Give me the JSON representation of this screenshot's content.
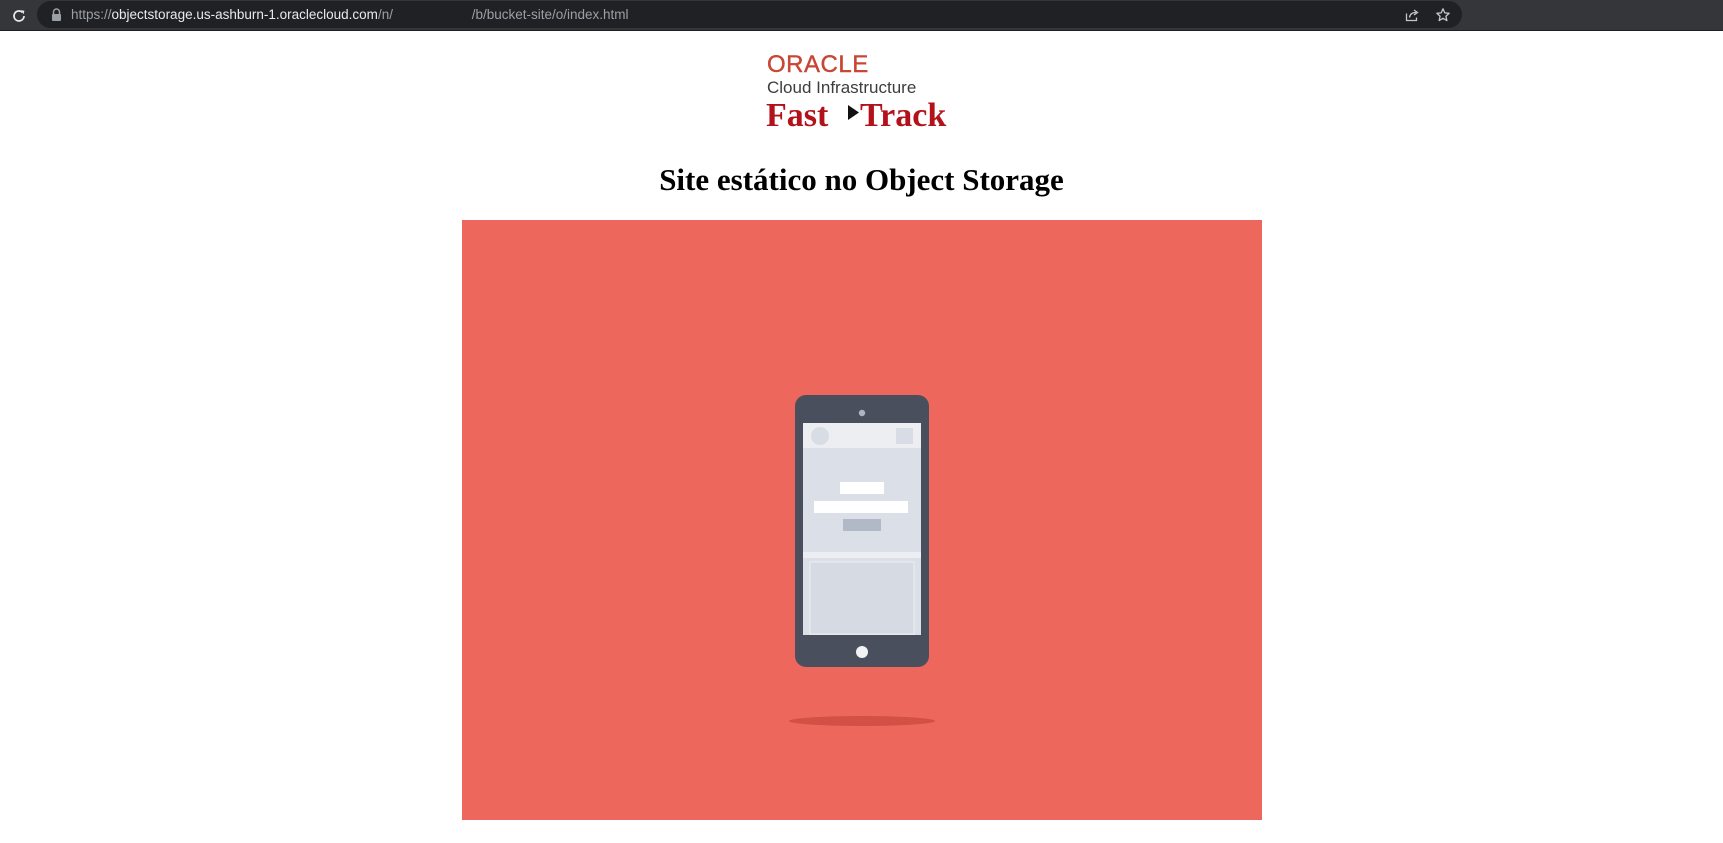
{
  "browser": {
    "url_scheme": "https://",
    "url_host": "objectstorage.us-ashburn-1.oraclecloud.com",
    "url_path_start": "/n/",
    "url_path_gap": "                     ",
    "url_path_end": "/b/bucket-site/o/index.html"
  },
  "logo": {
    "brand": "ORACLE",
    "product": "Cloud Infrastructure",
    "program_part1": "Fast",
    "program_part2": "Track"
  },
  "page": {
    "heading": "Site estático no Object Storage"
  },
  "colors": {
    "hero_background": "#ee675c",
    "oracle_red": "#c74634",
    "fasttrack_red": "#b3121b",
    "phone_body": "#4a4f5e",
    "phone_screen": "#dbe0e8"
  },
  "icons": {
    "reload": "reload-icon",
    "lock": "lock-icon",
    "share": "share-icon",
    "bookmark": "star-icon"
  }
}
